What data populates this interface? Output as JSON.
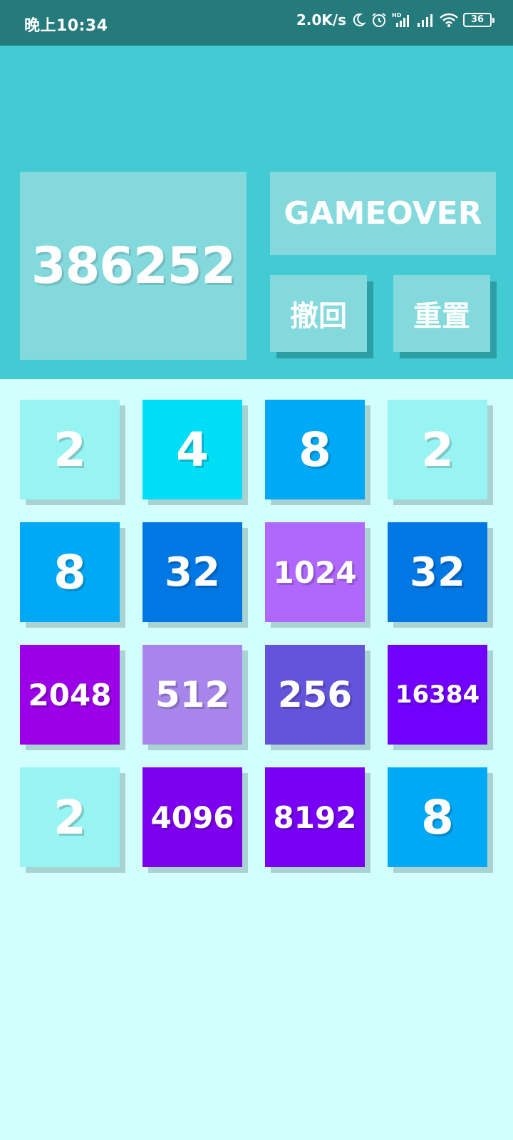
{
  "status_bar": {
    "time": "晚上10:34",
    "speed": "2.0K/s",
    "icons": [
      "moon-icon",
      "alarm-icon",
      "hd-signal-icon",
      "signal-icon",
      "wifi-icon"
    ],
    "battery": "36"
  },
  "header": {
    "score": "386252",
    "game_status": "GAMEOVER",
    "undo_label": "撤回",
    "reset_label": "重置",
    "bg_color": "#42cbd2",
    "panel_color": "#84d9dc"
  },
  "board": {
    "tiles": [
      {
        "value": "2",
        "color": "#98f4f3"
      },
      {
        "value": "4",
        "color": "#00ddf7"
      },
      {
        "value": "8",
        "color": "#00a9f6"
      },
      {
        "value": "2",
        "color": "#98f4f3"
      },
      {
        "value": "8",
        "color": "#00a9f6"
      },
      {
        "value": "32",
        "color": "#0077e3"
      },
      {
        "value": "1024",
        "color": "#b067fc"
      },
      {
        "value": "32",
        "color": "#0077e3"
      },
      {
        "value": "2048",
        "color": "#9b00e8"
      },
      {
        "value": "512",
        "color": "#a785eb"
      },
      {
        "value": "256",
        "color": "#6454db"
      },
      {
        "value": "16384",
        "color": "#7100fd"
      },
      {
        "value": "2",
        "color": "#98f4f3"
      },
      {
        "value": "4096",
        "color": "#7d00ee"
      },
      {
        "value": "8192",
        "color": "#7800f4"
      },
      {
        "value": "8",
        "color": "#00a9f6"
      }
    ]
  }
}
